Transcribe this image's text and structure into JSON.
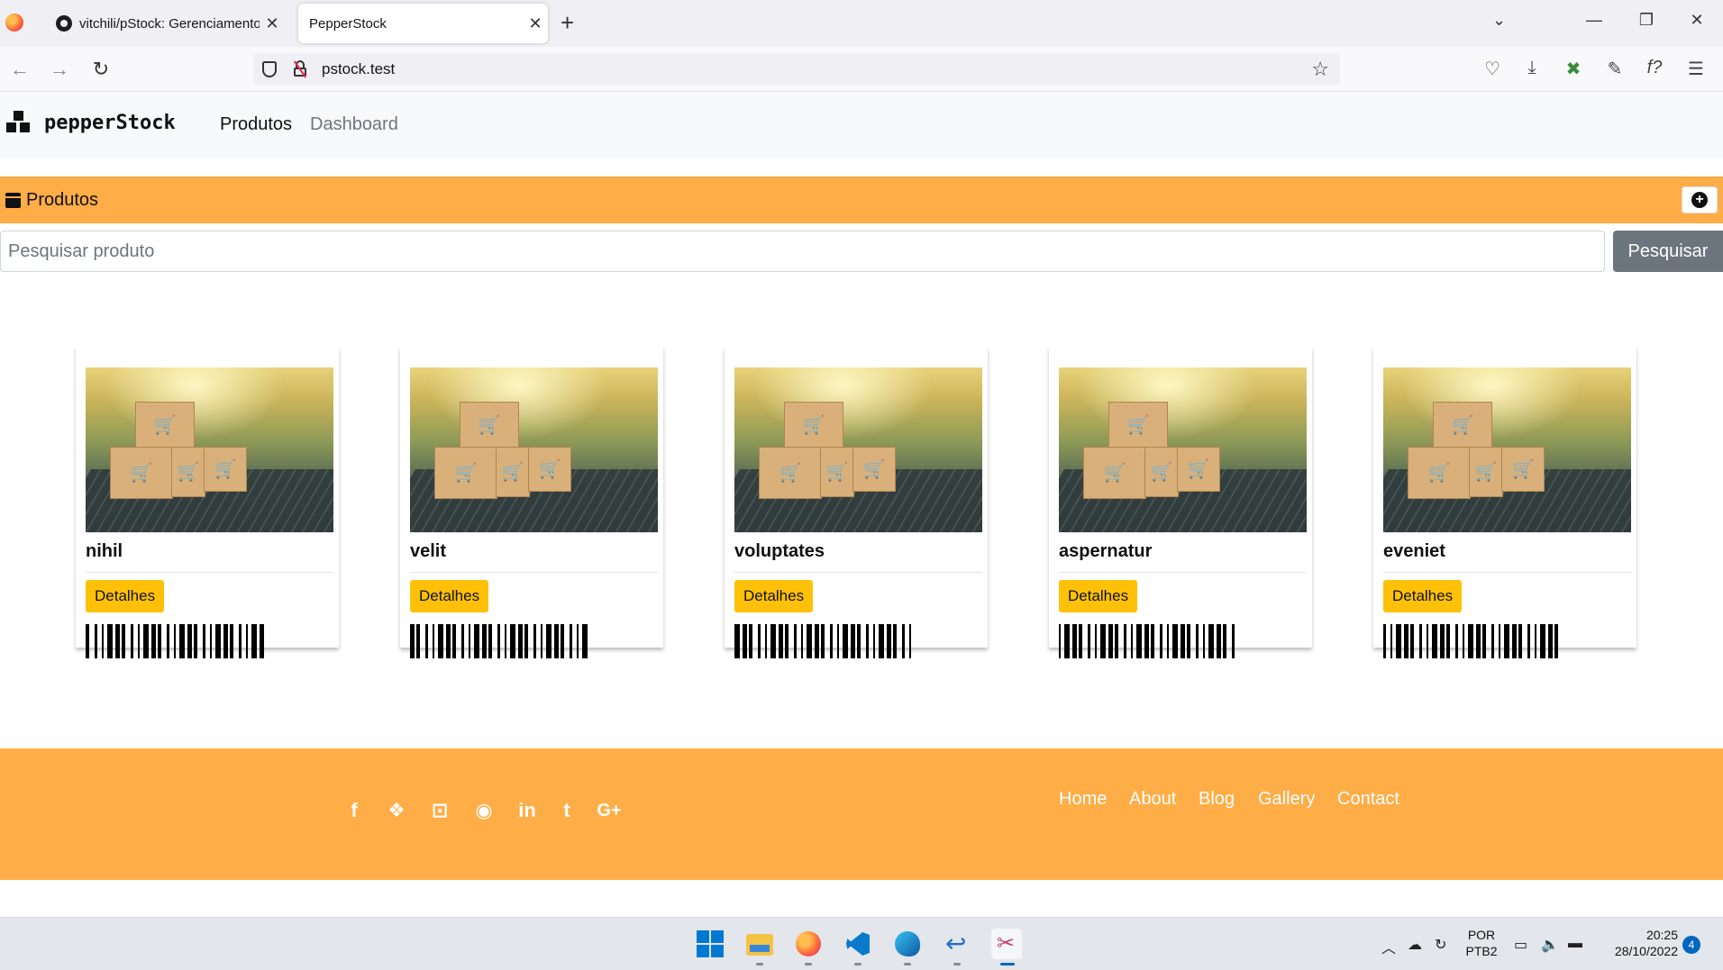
{
  "browser": {
    "tabs": [
      {
        "title": "vitchili/pStock: Gerenciamento d",
        "active": false,
        "icon": "github-icon"
      },
      {
        "title": "PepperStock",
        "active": true
      }
    ],
    "url": "pstock.test"
  },
  "app": {
    "brand": "pepperStock",
    "nav": {
      "produtos": "Produtos",
      "dashboard": "Dashboard"
    },
    "section_title": "Produtos",
    "search": {
      "placeholder": "Pesquisar produto",
      "button": "Pesquisar"
    },
    "detail_label": "Detalhes",
    "products": [
      {
        "name": "nihil"
      },
      {
        "name": "velit"
      },
      {
        "name": "voluptates"
      },
      {
        "name": "aspernatur"
      },
      {
        "name": "eveniet"
      }
    ],
    "footer": {
      "social": [
        "facebook-icon",
        "dropbox-icon",
        "flickr-icon",
        "github-icon",
        "linkedin-icon",
        "tumblr-icon",
        "google-plus-icon"
      ],
      "links": [
        "Home",
        "About",
        "Blog",
        "Gallery",
        "Contact"
      ]
    },
    "colors": {
      "accent": "#ffad47",
      "button": "#ffc107",
      "search_button": "#6c757d"
    }
  },
  "taskbar": {
    "lang": "POR",
    "layout": "PTB2",
    "time": "20:25",
    "date": "28/10/2022",
    "notifications": "4"
  }
}
